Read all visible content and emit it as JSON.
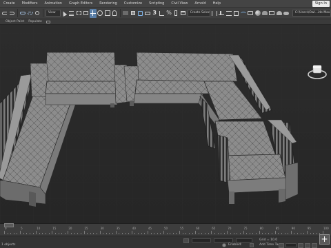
{
  "menu": {
    "items": [
      "Create",
      "Modifiers",
      "Animation",
      "Graph Editors",
      "Rendering",
      "Customize",
      "Scripting",
      "Civil View",
      "Arnold",
      "Help"
    ],
    "sign_in": "Sign In"
  },
  "toolbar": {
    "view_dropdown": "View",
    "selection_set": "Create Selection Se",
    "project_path": "C:\\Users\\Owl...ide Max 2024"
  },
  "ribbon": {
    "labels": [
      "Object Paint",
      "Populate"
    ]
  },
  "viewport": {
    "background": "#2b2b2b",
    "object_color": "#8a8a8a"
  },
  "timeline": {
    "ticks": [
      "0",
      "5",
      "10",
      "15",
      "20",
      "25",
      "30",
      "35",
      "40",
      "45",
      "50",
      "55",
      "60",
      "65",
      "70",
      "75",
      "80",
      "85",
      "90",
      "95",
      "100"
    ]
  },
  "status": {
    "objects_text": "1 objects",
    "grid_text": "Grid = 10.0",
    "enabled_label": "Enabled:",
    "add_time_tag": "Add Time Tag",
    "add_key": "+"
  }
}
